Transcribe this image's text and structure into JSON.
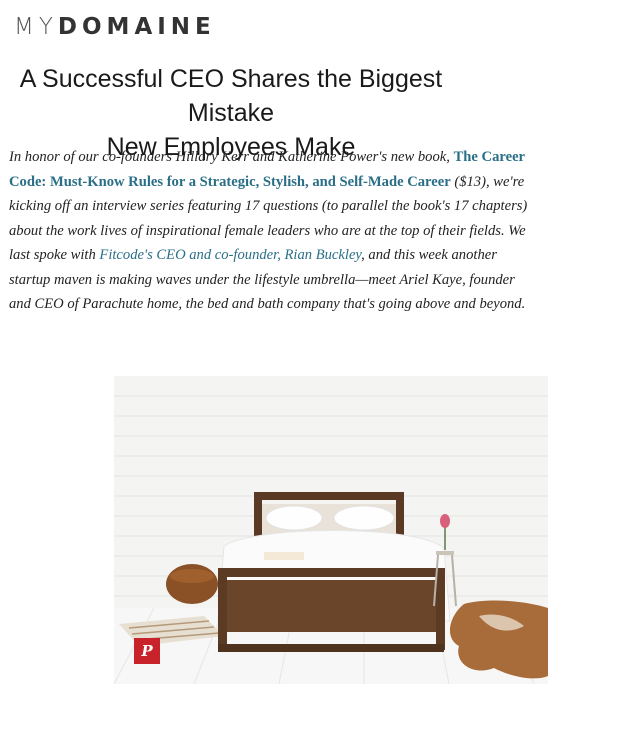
{
  "site": {
    "logo_prefix": "MY",
    "logo_main": "DOMAINE"
  },
  "article": {
    "headline_line1": "A Successful CEO Shares the Biggest Mistake",
    "headline_line2": "New Employees Make",
    "p1_intro": "In honor of our co-founders Hillary Kerr and Katherine Power's new book, ",
    "book_link": "The Career Code: Must-Know Rules for a Strategic, Stylish, and Self-Made Career",
    "p1_after_book": " ($13), we're kicking off an interview series featuring 17 questions (to parallel the book's 17 chapters) about the work lives of inspirational female leaders who are at the top of their fields. We last spoke with ",
    "person_link": "Fitcode's CEO and co-founder, Rian Buckley",
    "p1_end": ", and this week another startup maven is making waves under the lifestyle umbrella—meet Ariel Kaye, founder and CEO of Parachute home, the bed and bath company that's going above and beyond."
  },
  "image": {
    "pin_label": "P",
    "pin_icon": "pinterest-icon"
  },
  "colors": {
    "link": "#2a6f87",
    "pin_red": "#c8222b"
  }
}
